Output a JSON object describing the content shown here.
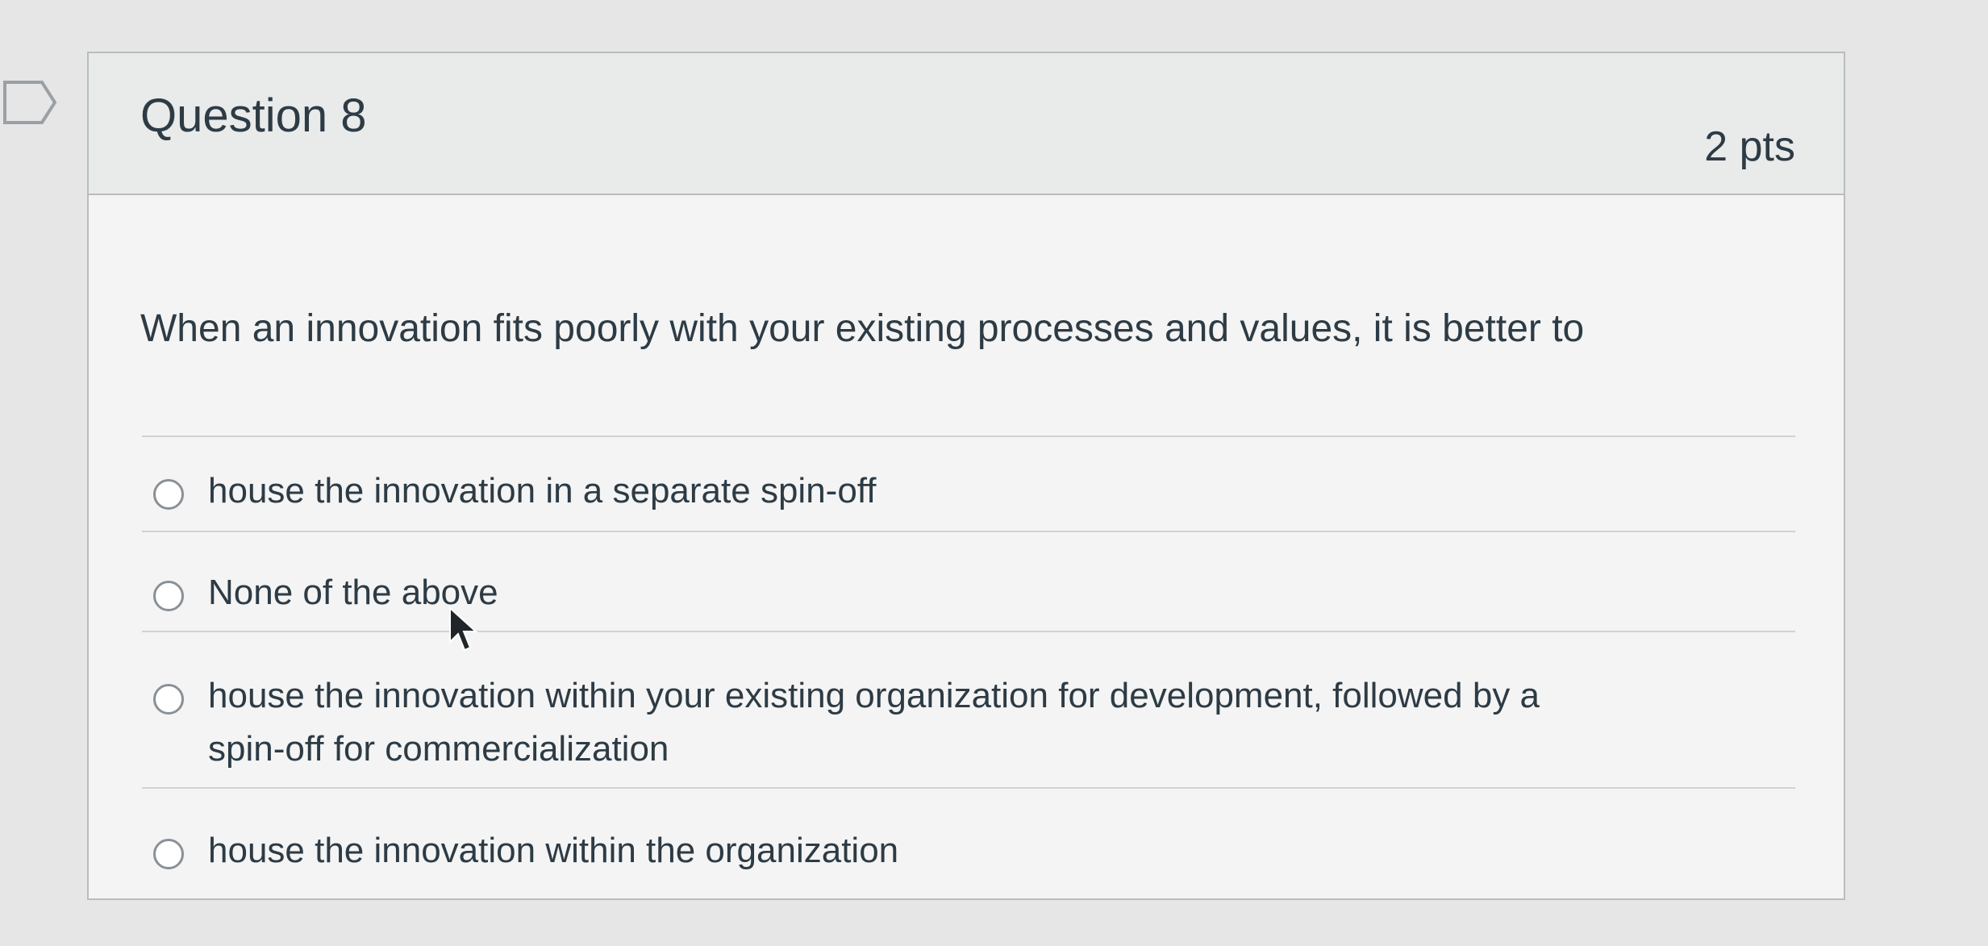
{
  "question": {
    "title": "Question 8",
    "points": "2 pts",
    "text": "When an innovation fits poorly with your existing processes and values, it is better to",
    "flag_icon": "flag-outline-icon",
    "answers": [
      {
        "label": "house the innovation in a separate spin-off",
        "selected": false
      },
      {
        "label": "None of the above",
        "selected": false
      },
      {
        "label": "house the innovation within your existing organization for development, followed by a spin-off for commercialization",
        "selected": false
      },
      {
        "label": "house the innovation within the organization",
        "selected": false
      }
    ]
  },
  "colors": {
    "text": "#2d3b45",
    "card_border": "#b9bcbf",
    "header_bg": "#e9eaea",
    "radio_border": "#8a9096"
  }
}
